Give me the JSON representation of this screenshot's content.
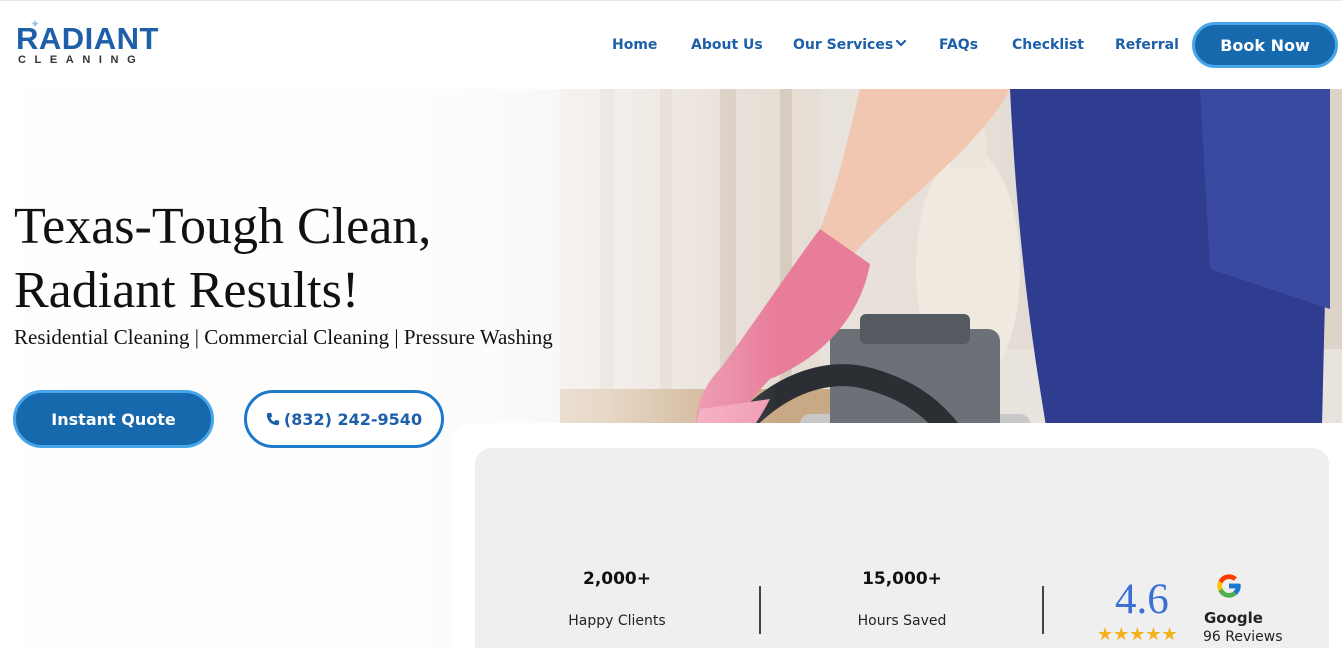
{
  "brand": {
    "name": "RADIANT",
    "tagline": "CLEANING"
  },
  "nav": {
    "items": [
      "Home",
      "About Us",
      "Our Services",
      "FAQs",
      "Checklist",
      "Referral"
    ],
    "cta": "Book Now"
  },
  "hero": {
    "title_line1": "Texas-Tough Clean,",
    "title_line2": "Radiant Results!",
    "subtitle": "Residential Cleaning | Commercial Cleaning | Pressure Washing",
    "primary_button": "Instant Quote",
    "phone_button": "(832) 242-9540"
  },
  "stats": {
    "clients_value": "2,000+",
    "clients_label": "Happy Clients",
    "hours_value": "15,000+",
    "hours_label": "Hours Saved",
    "rating": "4.6",
    "stars": "★★★★★",
    "review_source": "Google",
    "reviews": "96 Reviews"
  },
  "colors": {
    "brand_blue": "#1d5fa8",
    "button_blue": "#1669ad",
    "button_border": "#47a6ea",
    "star_gold": "#f3b21c",
    "rating_blue": "#3a6fd8"
  },
  "icons": [
    "chevron-down-icon",
    "phone-icon",
    "google-logo-icon",
    "star-icon"
  ]
}
